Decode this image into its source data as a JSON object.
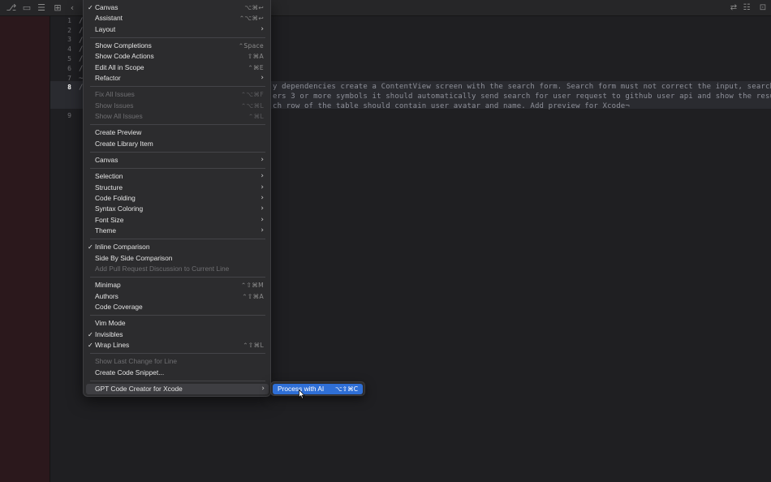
{
  "editor": {
    "line_numbers": [
      "1",
      "2",
      "3",
      "4",
      "5",
      "6",
      "7",
      "8",
      "9"
    ],
    "active_line": "8",
    "code_lines": [
      "y dependencies create a ContentView screen with the search form. Search form must not correct the input, search",
      "ers 3 or more symbols it should automatically send search for user request to github user api and show the result",
      "ch row of the table should contain user avatar and name. Add preview for Xcode¬"
    ]
  },
  "menu": {
    "items": [
      {
        "label": "Canvas",
        "check": "✓",
        "shortcut": "⌥⌘↩"
      },
      {
        "label": "Assistant",
        "shortcut": "⌃⌥⌘↩"
      },
      {
        "label": "Layout",
        "arrow": "›"
      },
      {
        "label": "Show Completions",
        "shortcut": "⌃Space"
      },
      {
        "label": "Show Code Actions",
        "shortcut": "⇧⌘A"
      },
      {
        "label": "Edit All in Scope",
        "shortcut": "⌃⌘E"
      },
      {
        "label": "Refactor",
        "arrow": "›"
      },
      {
        "label": "Fix All Issues",
        "shortcut": "⌃⌥⌘F",
        "disabled": true
      },
      {
        "label": "Show Issues",
        "shortcut": "⌃⌥⌘L",
        "disabled": true
      },
      {
        "label": "Show All Issues",
        "shortcut": "⌃⌘L",
        "disabled": true
      },
      {
        "label": "Create Preview"
      },
      {
        "label": "Create Library Item"
      },
      {
        "label": "Canvas",
        "arrow": "›"
      },
      {
        "label": "Selection",
        "arrow": "›"
      },
      {
        "label": "Structure",
        "arrow": "›"
      },
      {
        "label": "Code Folding",
        "arrow": "›"
      },
      {
        "label": "Syntax Coloring",
        "arrow": "›"
      },
      {
        "label": "Font Size",
        "arrow": "›"
      },
      {
        "label": "Theme",
        "arrow": "›"
      },
      {
        "label": "Inline Comparison",
        "check": "✓"
      },
      {
        "label": "Side By Side Comparison"
      },
      {
        "label": "Add Pull Request Discussion to Current Line",
        "disabled": true
      },
      {
        "label": "Minimap",
        "shortcut": "⌃⇧⌘M"
      },
      {
        "label": "Authors",
        "shortcut": "⌃⇧⌘A"
      },
      {
        "label": "Code Coverage"
      },
      {
        "label": "Vim Mode"
      },
      {
        "label": "Invisibles",
        "check": "✓"
      },
      {
        "label": "Wrap Lines",
        "check": "✓",
        "shortcut": "⌃⇧⌘L"
      },
      {
        "label": "Show Last Change for Line",
        "disabled": true
      },
      {
        "label": "Create Code Snippet..."
      },
      {
        "label": "GPT Code Creator for Xcode",
        "arrow": "›",
        "highlighted": true
      }
    ]
  },
  "submenu": {
    "label": "Process with AI",
    "shortcut": "⌥⇧⌘C"
  },
  "colors": {
    "accent": "#2f6fd6",
    "menu_bg": "#2c2c2e",
    "editor_bg": "#1f1f22",
    "sidebar_bg": "#2b181c"
  },
  "icons": {
    "toolbar_left": [
      "source-control-icon",
      "folder-icon",
      "document-icon",
      "grid-icon",
      "back-icon"
    ],
    "toolbar_right": [
      "swap-icon",
      "inspector-icon",
      "canvas-icon"
    ]
  }
}
